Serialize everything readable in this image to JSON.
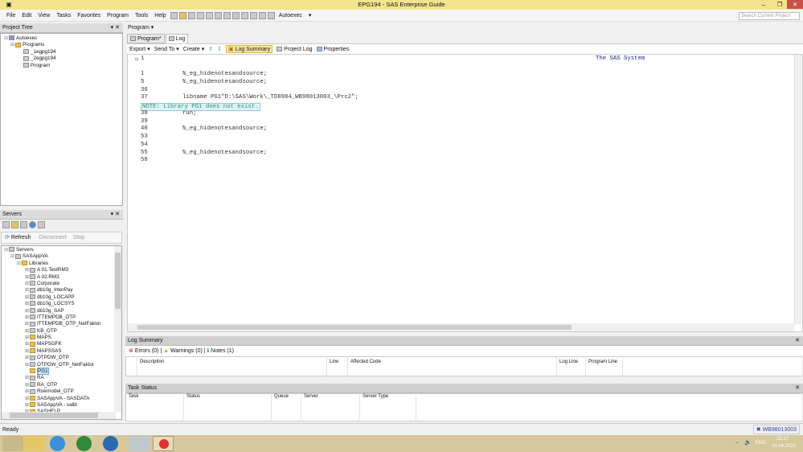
{
  "title": "EPG194 - SAS Enterprise Guide",
  "menu": [
    "File",
    "Edit",
    "View",
    "Tasks",
    "Favorites",
    "Program",
    "Tools",
    "Help"
  ],
  "toolbar": {
    "autoexec": "Autoexec"
  },
  "search_placeholder": "Search Current Project",
  "project_tree": {
    "title": "Project Tree",
    "items": [
      {
        "label": "Autoexec",
        "level": 0
      },
      {
        "label": "Programs",
        "level": 1
      },
      {
        "label": "_1egpg194",
        "level": 2
      },
      {
        "label": "_2egpg194",
        "level": 2
      },
      {
        "label": "Program",
        "level": 2
      }
    ]
  },
  "servers": {
    "title": "Servers",
    "refresh": "Refresh",
    "disconnect": "Disconnect",
    "stop": "Stop",
    "root": "Servers",
    "server": "SASAppVA",
    "libraries": "Libraries",
    "libs": [
      "A 01.TestRM3",
      "A 02.RM3",
      "Corporate",
      "db10g_InterPay",
      "db10g_LOCAPP",
      "db10g_LOCSYS",
      "db10g_SAP",
      "ITTEMPDB_OTP",
      "ITTEMPDB_OTP_NetFaktor",
      "KB_OTP",
      "MAPS",
      "MAPSGFK",
      "MAPSSAS",
      "OTPDW_OTP",
      "OTPDW_OTP_NetFaktor",
      "PG1",
      "RA",
      "RA_OTP",
      "Riskmodel_OTP",
      "SASAppVA - SASDATA",
      "SASAppVA - valib",
      "SASHELP"
    ],
    "selected": "PG1"
  },
  "program_header": "Program",
  "tabs": [
    {
      "label": "Program*"
    },
    {
      "label": "Log",
      "active": true
    }
  ],
  "log_toolbar": {
    "export": "Export",
    "send_to": "Send To",
    "create": "Create",
    "log_summary": "Log Summary",
    "project_log": "Project Log",
    "properties": "Properties"
  },
  "log": {
    "page": "1",
    "system_title": "The SAS System",
    "lines": [
      {
        "n": "1",
        "code": "%_eg_hidenotesandsource;"
      },
      {
        "n": "5",
        "code": "%_eg_hidenotesandsource;"
      },
      {
        "n": "36",
        "code": ""
      },
      {
        "n": "37",
        "code": "libname PG1\"D:\\SAS\\Work\\_TD8984_WB98013003_\\Prc2\";"
      },
      {
        "note": "NOTE: Library PG1 does not exist."
      },
      {
        "n": "38",
        "code": "run;"
      },
      {
        "n": "39",
        "code": ""
      },
      {
        "n": "40",
        "code": "%_eg_hidenotesandsource;"
      },
      {
        "n": "53",
        "code": ""
      },
      {
        "n": "54",
        "code": ""
      },
      {
        "n": "55",
        "code": "%_eg_hidenotesandsource;"
      },
      {
        "n": "58",
        "code": ""
      }
    ]
  },
  "log_summary": {
    "title": "Log Summary",
    "errors": "Errors (0)",
    "warnings": "Warnings (0)",
    "notes": "Notes (1)",
    "columns": [
      "Description",
      "Line",
      "Affected Code",
      "Log Line",
      "Program Line"
    ]
  },
  "task_status": {
    "title": "Task Status",
    "columns": [
      "Task",
      "Status",
      "Queue",
      "Server",
      "Server Type"
    ]
  },
  "status": {
    "text": "Ready",
    "server": "WB98013003"
  },
  "tray": {
    "lang": "ENG",
    "time": "23:27",
    "date": "24.04.2020"
  }
}
